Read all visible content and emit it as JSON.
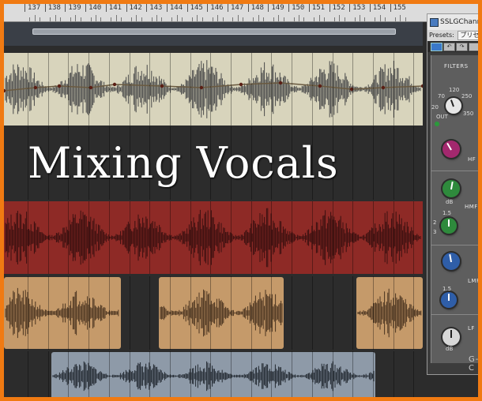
{
  "ruler": {
    "ticks": [
      "137",
      "138",
      "139",
      "140",
      "141",
      "142",
      "143",
      "144",
      "145",
      "146",
      "147",
      "148",
      "149",
      "150",
      "151",
      "152",
      "153",
      "154",
      "155"
    ]
  },
  "overlay": {
    "title": "Mixing Vocals"
  },
  "plugin": {
    "title": "SSLGChannel M",
    "presets_label": "Presets:",
    "preset_value": "プリセットなし",
    "toolbar": {
      "undo_label": "↶",
      "redo_label": "↷"
    },
    "sections": {
      "filters": "FILTERS",
      "hf": "HF",
      "hmf": "HMF",
      "lmf": "LMF",
      "lf": "LF"
    },
    "filter_labels": {
      "hz_top": "120",
      "left_70": "70",
      "right_250": "250",
      "left_20": "20",
      "right_350": "350",
      "out": "OUT"
    },
    "q_labels": {
      "q_top_1": "1.5",
      "q_2": "2",
      "q_3": "3",
      "q_top_2": "1.5"
    },
    "unit_db": "dB",
    "footer": "G-C",
    "colors": {
      "hf": "#a3286e",
      "hmf": "#2e8a3c",
      "lmf": "#2f5ea8",
      "lf": "#d8d8d8",
      "filter": "#e6e6e6"
    }
  },
  "tracks": {
    "colors": [
      "#d8d4bc",
      "#2c2c2c",
      "#8e2a26",
      "#c59a6a",
      "#8e9aa8"
    ]
  }
}
